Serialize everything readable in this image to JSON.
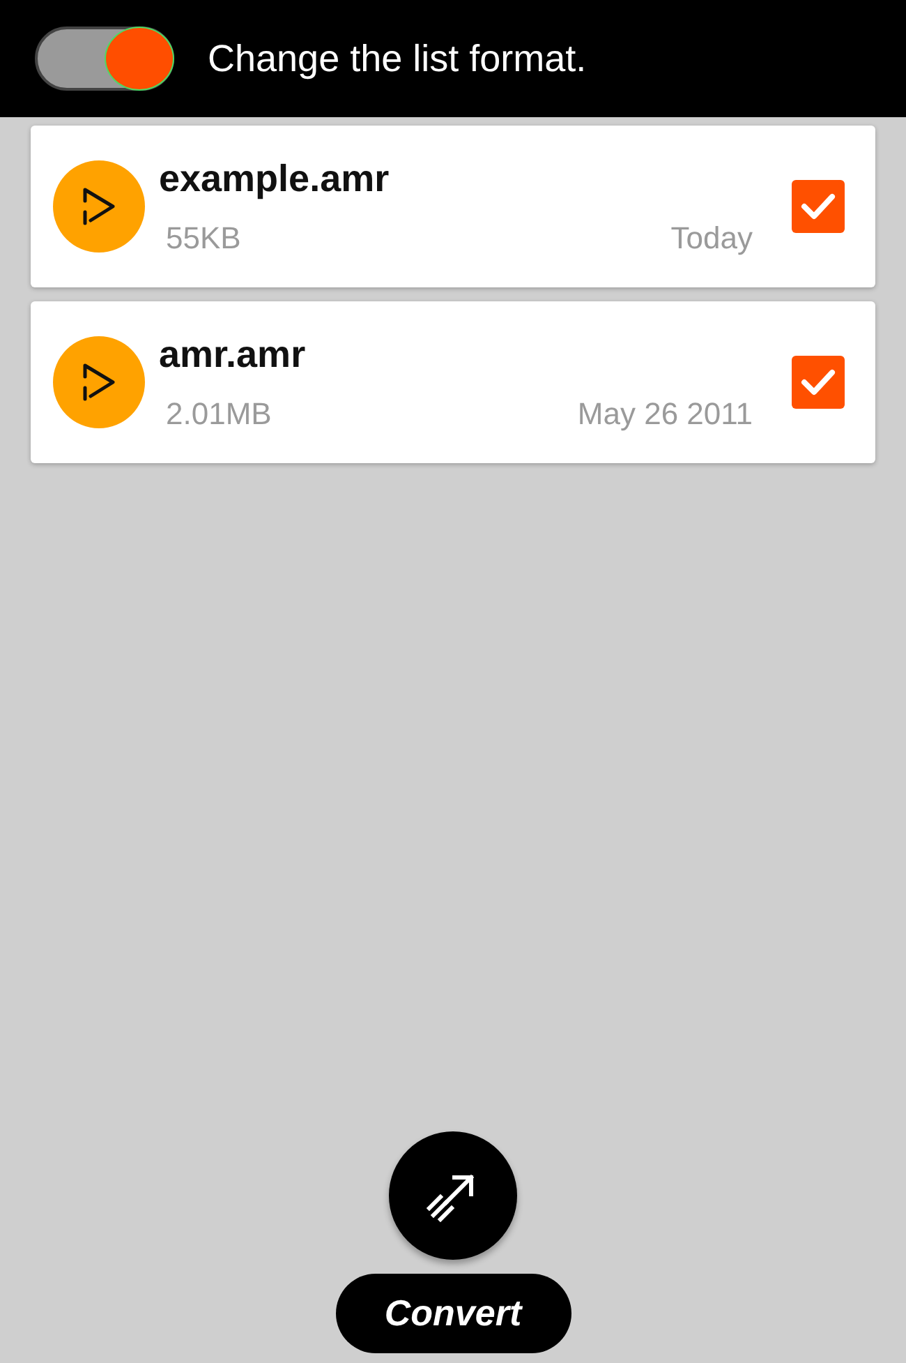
{
  "header": {
    "toggle": {
      "on": true
    },
    "label": "Change the list format."
  },
  "files": [
    {
      "name": "example.amr",
      "size": "55KB",
      "date": "Today",
      "checked": true
    },
    {
      "name": "amr.amr",
      "size": "2.01MB",
      "date": "May 26 2011",
      "checked": true
    }
  ],
  "convert": {
    "label": "Convert"
  }
}
